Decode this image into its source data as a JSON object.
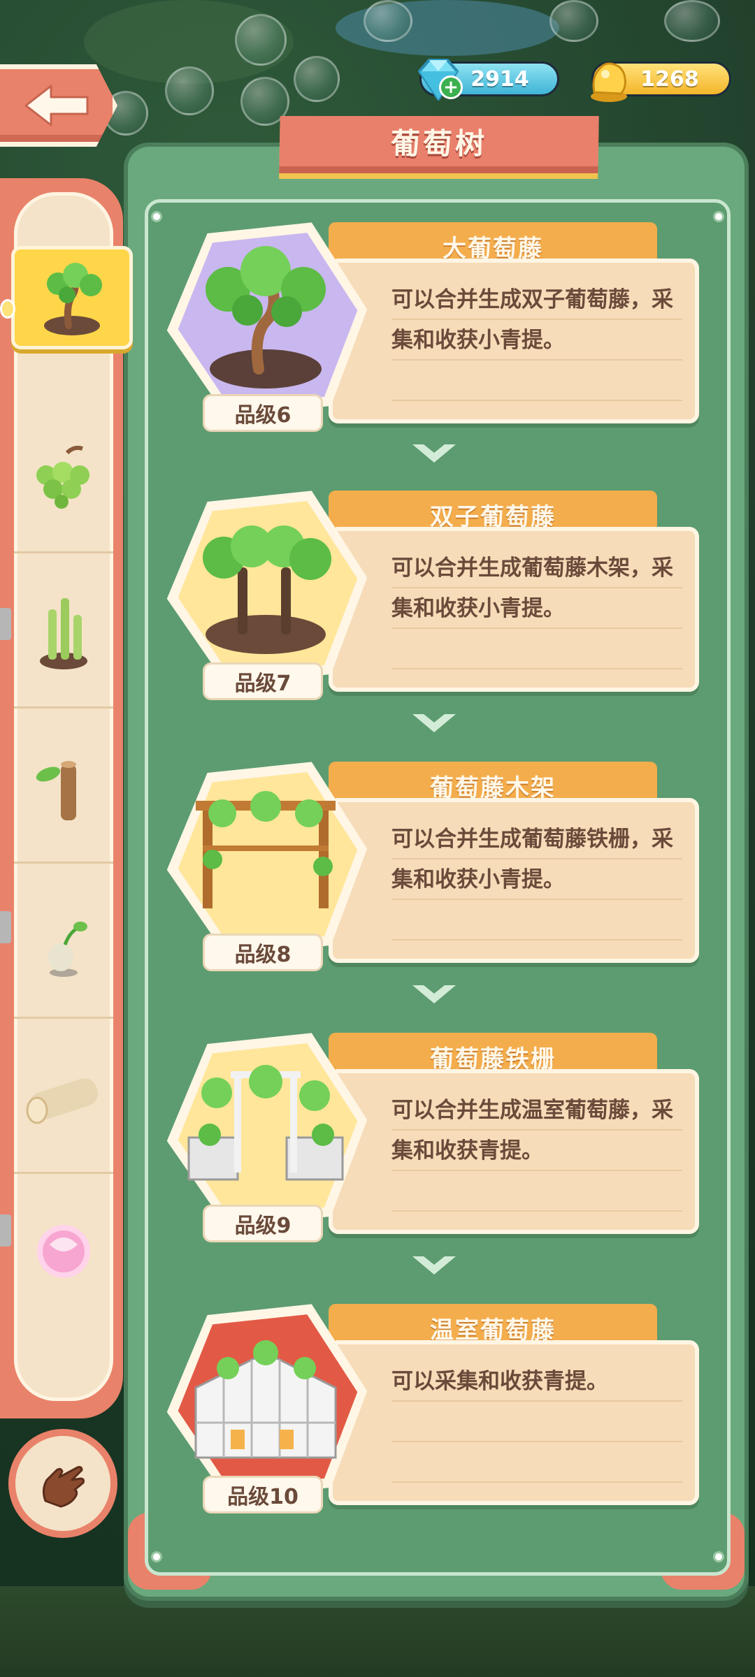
{
  "header": {
    "title": "葡萄树",
    "back_icon": "back-arrow-icon"
  },
  "currency": {
    "gems": "2914",
    "coins": "1268"
  },
  "sidebar": {
    "items": [
      {
        "icon": "grape-tree-icon",
        "active": true
      },
      {
        "icon": "grapes-icon",
        "active": false
      },
      {
        "icon": "bamboo-icon",
        "active": false
      },
      {
        "icon": "sprout-stump-icon",
        "active": false
      },
      {
        "icon": "seed-sprout-icon",
        "active": false
      },
      {
        "icon": "log-icon",
        "active": false
      },
      {
        "icon": "pink-orb-icon",
        "active": false
      }
    ],
    "hand_button_icon": "hand-pointer-icon"
  },
  "cards": [
    {
      "name": "大葡萄藤",
      "desc": "可以合并生成双子葡萄藤，采集和收获小青提。",
      "level": "品级6",
      "hex_color": "#c9b7ef"
    },
    {
      "name": "双子葡萄藤",
      "desc": "可以合并生成葡萄藤木架，采集和收获小青提。",
      "level": "品级7",
      "hex_color": "#ffe69a"
    },
    {
      "name": "葡萄藤木架",
      "desc": "可以合并生成葡萄藤铁栅，采集和收获小青提。",
      "level": "品级8",
      "hex_color": "#ffe69a"
    },
    {
      "name": "葡萄藤铁栅",
      "desc": "可以合并生成温室葡萄藤，采集和收获青提。",
      "level": "品级9",
      "hex_color": "#ffe69a"
    },
    {
      "name": "温室葡萄藤",
      "desc": "可以采集和收获青提。",
      "level": "品级10",
      "hex_color": "#e25a45"
    }
  ],
  "colors": {
    "panel_green": "#6aa97d",
    "banner_coral": "#e9806c",
    "tab_orange": "#f4ad4c",
    "desc_beige": "#f6dcb8"
  }
}
